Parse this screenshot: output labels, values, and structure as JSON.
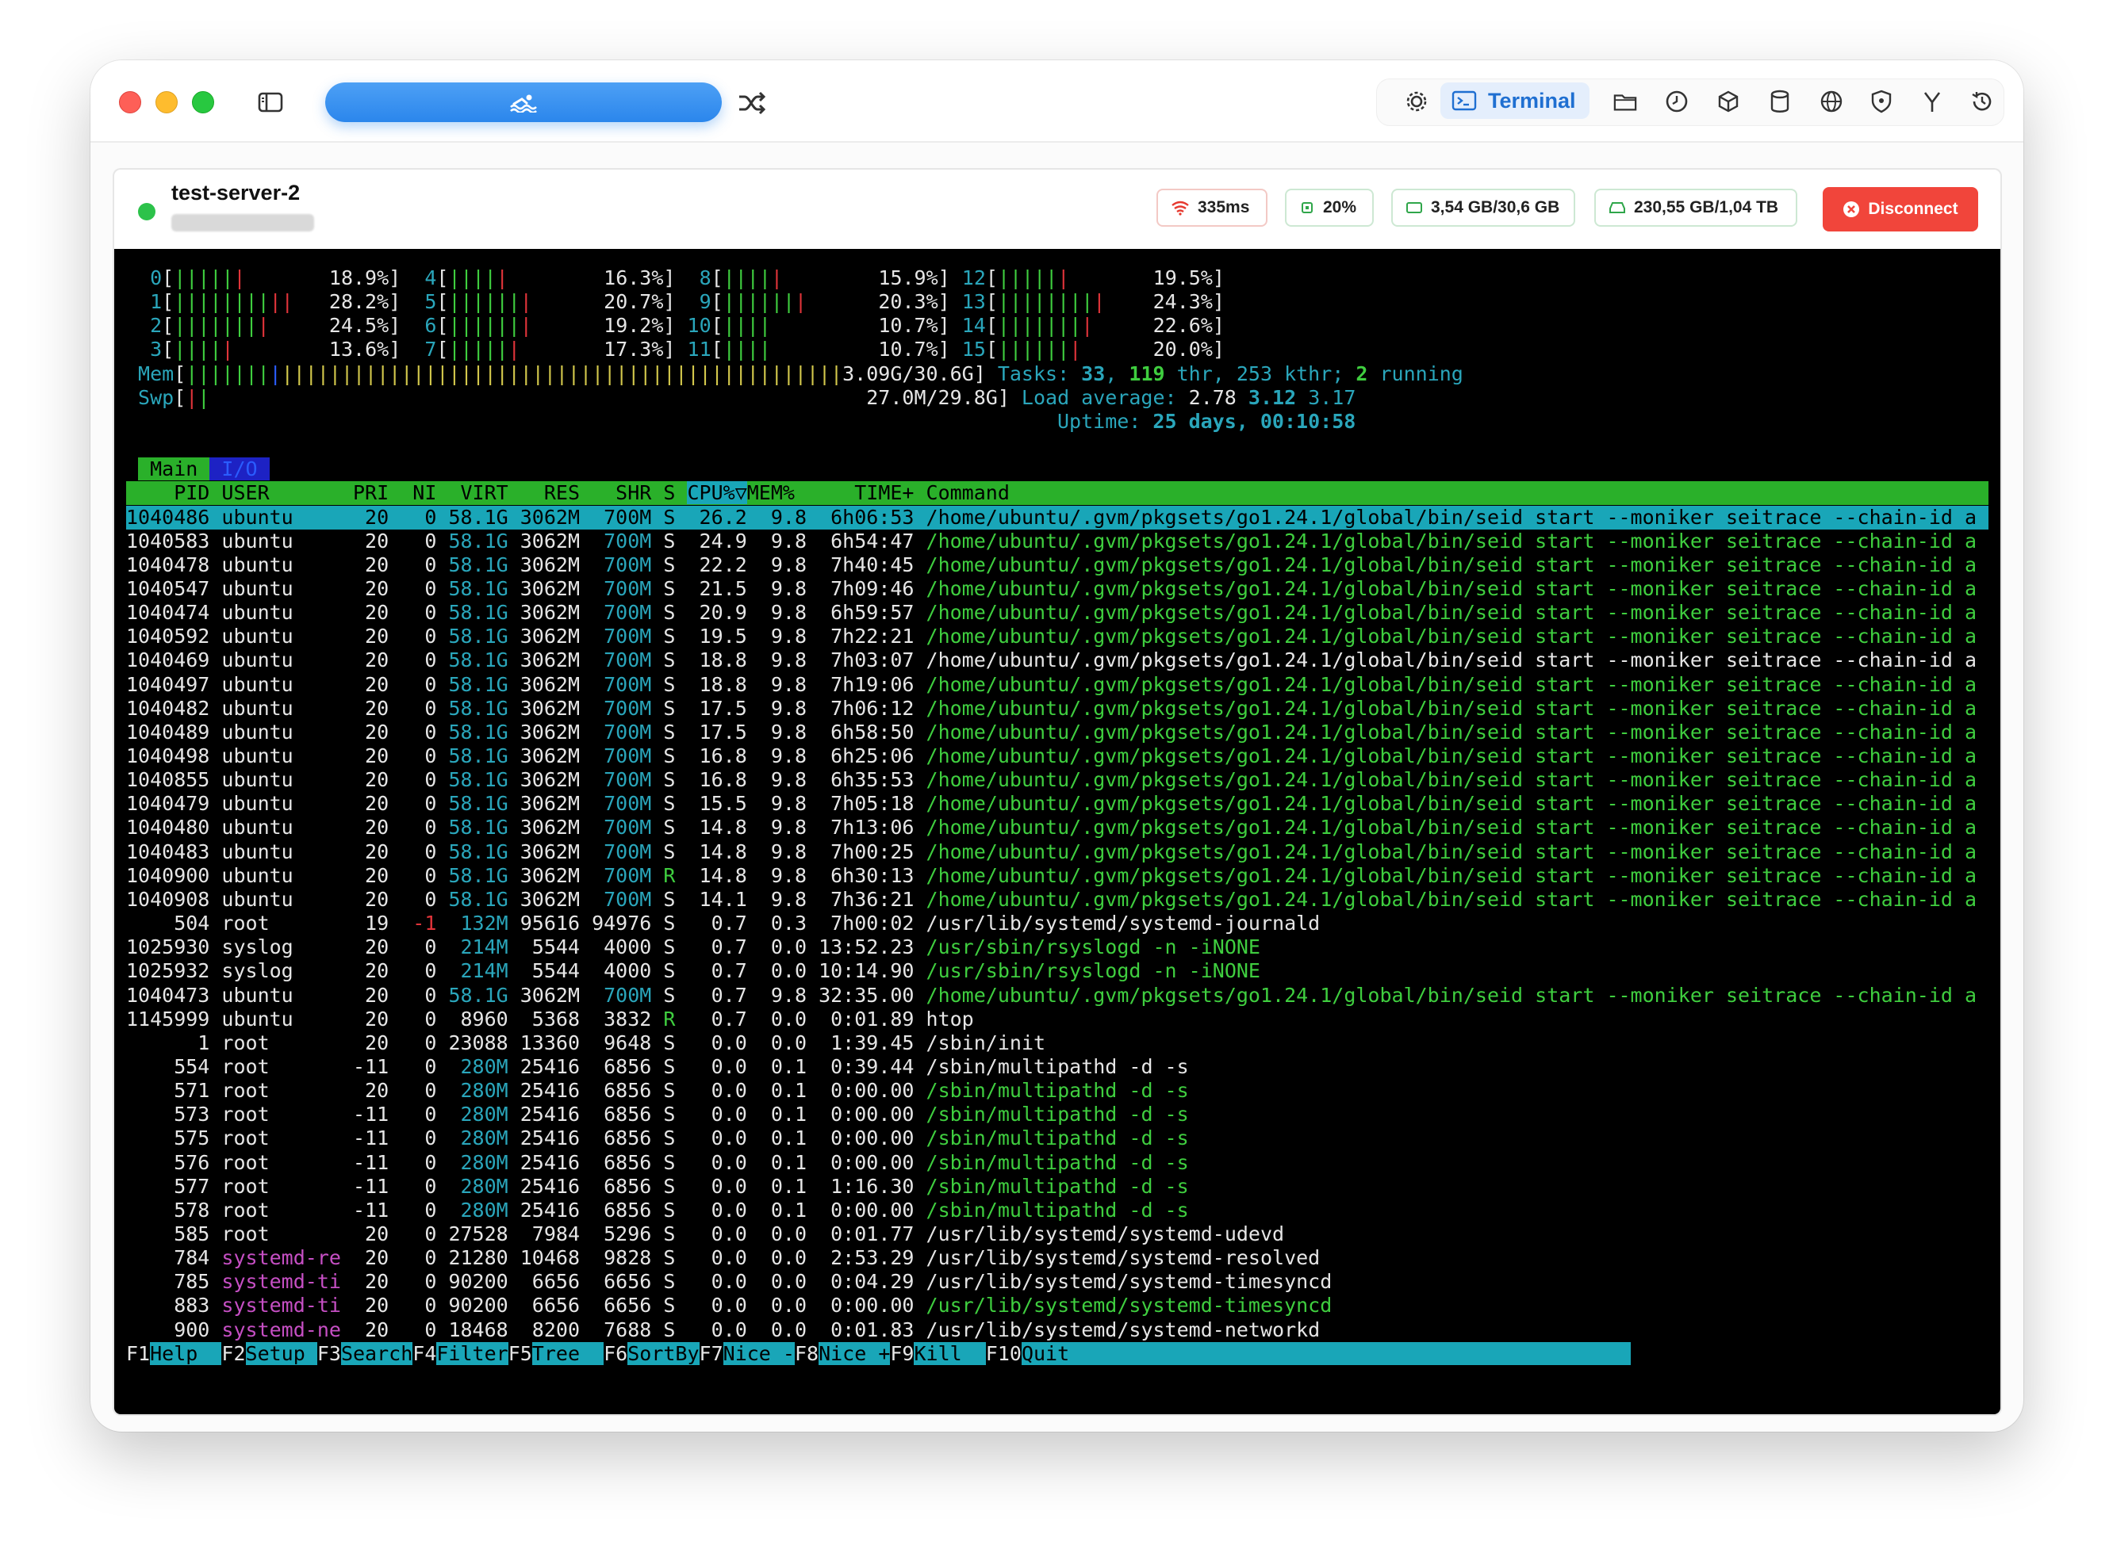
{
  "app": {
    "toolbar": {
      "terminal_label": "Terminal",
      "icons": [
        "sidebar-icon",
        "swimmer-icon",
        "shuffle-icon",
        "gear-icon",
        "terminal-icon",
        "folder-icon",
        "clock-icon",
        "cube-icon",
        "database-icon",
        "globe-icon",
        "shield-icon",
        "fork-icon",
        "history-icon"
      ]
    },
    "server": {
      "name": "test-server-2",
      "status_color": "#2cc24a",
      "latency": "335ms",
      "cpu": "20%",
      "memory": "3,54 GB/30,6 GB",
      "disk": "230,55 GB/1,04 TB",
      "disconnect_label": "Disconnect"
    }
  },
  "htop": {
    "cpus": [
      {
        "id": "0",
        "bar_g": "|||||",
        "bar_r": "|",
        "pct": "18.9%"
      },
      {
        "id": "1",
        "bar_g": "||||||||",
        "bar_r": "||",
        "pct": "28.2%"
      },
      {
        "id": "2",
        "bar_g": "|||||||",
        "bar_r": "|",
        "pct": "24.5%"
      },
      {
        "id": "3",
        "bar_g": "||||",
        "bar_r": "|",
        "pct": "13.6%"
      },
      {
        "id": "4",
        "bar_g": "||||",
        "bar_r": "|",
        "pct": "16.3%"
      },
      {
        "id": "5",
        "bar_g": "||||||",
        "bar_r": "|",
        "pct": "20.7%"
      },
      {
        "id": "6",
        "bar_g": "||||||",
        "bar_r": "|",
        "pct": "19.2%"
      },
      {
        "id": "7",
        "bar_g": "|||||",
        "bar_r": "|",
        "pct": "17.3%"
      },
      {
        "id": "8",
        "bar_g": "||||",
        "bar_r": "|",
        "pct": "15.9%"
      },
      {
        "id": "9",
        "bar_g": "||||||",
        "bar_r": "|",
        "pct": "20.3%"
      },
      {
        "id": "10",
        "bar_g": "||||",
        "bar_r": "",
        "pct": "10.7%"
      },
      {
        "id": "11",
        "bar_g": "||||",
        "bar_r": "",
        "pct": "10.7%"
      },
      {
        "id": "12",
        "bar_g": "|||||",
        "bar_r": "|",
        "pct": "19.5%"
      },
      {
        "id": "13",
        "bar_g": "||||||||",
        "bar_r": "|",
        "pct": "24.3%"
      },
      {
        "id": "14",
        "bar_g": "|||||||",
        "bar_r": "|",
        "pct": "22.6%"
      },
      {
        "id": "15",
        "bar_g": "||||||",
        "bar_r": "|",
        "pct": "20.0%"
      }
    ],
    "mem_label": "Mem",
    "mem_value": "3.09G/30.6G",
    "swp_label": "Swp",
    "swp_value": "27.0M/29.8G",
    "tasks_label": "Tasks:",
    "tasks": "33",
    "thr": "119",
    "thr_label": "thr,",
    "kthr": "253 kthr;",
    "running": "2",
    "running_label": "running",
    "load_label": "Load average:",
    "load1": "2.78",
    "load5": "3.12",
    "load15": "3.17",
    "uptime_label": "Uptime:",
    "uptime": "25 days, 00:10:58",
    "tabs": [
      "Main",
      "I/O"
    ],
    "header": [
      "PID",
      "USER",
      "PRI",
      "NI",
      "VIRT",
      "RES",
      "SHR",
      "S",
      "CPU%▽",
      "MEM%",
      "TIME+",
      "Command"
    ],
    "rows": [
      [
        "1040486",
        "ubuntu",
        "20",
        "0",
        "58.1G",
        "3062M",
        "700M",
        "S",
        "26.2",
        "9.8",
        "6h06:53",
        "/home/ubuntu/.gvm/pkgsets/go1.24.1/global/bin/seid start --moniker seitrace --chain-id a"
      ],
      [
        "1040583",
        "ubuntu",
        "20",
        "0",
        "58.1G",
        "3062M",
        "700M",
        "S",
        "24.9",
        "9.8",
        "6h54:47",
        "/home/ubuntu/.gvm/pkgsets/go1.24.1/global/bin/seid start --moniker seitrace --chain-id a"
      ],
      [
        "1040478",
        "ubuntu",
        "20",
        "0",
        "58.1G",
        "3062M",
        "700M",
        "S",
        "22.2",
        "9.8",
        "7h40:45",
        "/home/ubuntu/.gvm/pkgsets/go1.24.1/global/bin/seid start --moniker seitrace --chain-id a"
      ],
      [
        "1040547",
        "ubuntu",
        "20",
        "0",
        "58.1G",
        "3062M",
        "700M",
        "S",
        "21.5",
        "9.8",
        "7h09:46",
        "/home/ubuntu/.gvm/pkgsets/go1.24.1/global/bin/seid start --moniker seitrace --chain-id a"
      ],
      [
        "1040474",
        "ubuntu",
        "20",
        "0",
        "58.1G",
        "3062M",
        "700M",
        "S",
        "20.9",
        "9.8",
        "6h59:57",
        "/home/ubuntu/.gvm/pkgsets/go1.24.1/global/bin/seid start --moniker seitrace --chain-id a"
      ],
      [
        "1040592",
        "ubuntu",
        "20",
        "0",
        "58.1G",
        "3062M",
        "700M",
        "S",
        "19.5",
        "9.8",
        "7h22:21",
        "/home/ubuntu/.gvm/pkgsets/go1.24.1/global/bin/seid start --moniker seitrace --chain-id a"
      ],
      [
        "1040469",
        "ubuntu",
        "20",
        "0",
        "58.1G",
        "3062M",
        "700M",
        "S",
        "18.8",
        "9.8",
        "7h03:07",
        "/home/ubuntu/.gvm/pkgsets/go1.24.1/global/bin/seid start --moniker seitrace --chain-id a"
      ],
      [
        "1040497",
        "ubuntu",
        "20",
        "0",
        "58.1G",
        "3062M",
        "700M",
        "S",
        "18.8",
        "9.8",
        "7h19:06",
        "/home/ubuntu/.gvm/pkgsets/go1.24.1/global/bin/seid start --moniker seitrace --chain-id a"
      ],
      [
        "1040482",
        "ubuntu",
        "20",
        "0",
        "58.1G",
        "3062M",
        "700M",
        "S",
        "17.5",
        "9.8",
        "7h06:12",
        "/home/ubuntu/.gvm/pkgsets/go1.24.1/global/bin/seid start --moniker seitrace --chain-id a"
      ],
      [
        "1040489",
        "ubuntu",
        "20",
        "0",
        "58.1G",
        "3062M",
        "700M",
        "S",
        "17.5",
        "9.8",
        "6h58:50",
        "/home/ubuntu/.gvm/pkgsets/go1.24.1/global/bin/seid start --moniker seitrace --chain-id a"
      ],
      [
        "1040498",
        "ubuntu",
        "20",
        "0",
        "58.1G",
        "3062M",
        "700M",
        "S",
        "16.8",
        "9.8",
        "6h25:06",
        "/home/ubuntu/.gvm/pkgsets/go1.24.1/global/bin/seid start --moniker seitrace --chain-id a"
      ],
      [
        "1040855",
        "ubuntu",
        "20",
        "0",
        "58.1G",
        "3062M",
        "700M",
        "S",
        "16.8",
        "9.8",
        "6h35:53",
        "/home/ubuntu/.gvm/pkgsets/go1.24.1/global/bin/seid start --moniker seitrace --chain-id a"
      ],
      [
        "1040479",
        "ubuntu",
        "20",
        "0",
        "58.1G",
        "3062M",
        "700M",
        "S",
        "15.5",
        "9.8",
        "7h05:18",
        "/home/ubuntu/.gvm/pkgsets/go1.24.1/global/bin/seid start --moniker seitrace --chain-id a"
      ],
      [
        "1040480",
        "ubuntu",
        "20",
        "0",
        "58.1G",
        "3062M",
        "700M",
        "S",
        "14.8",
        "9.8",
        "7h13:06",
        "/home/ubuntu/.gvm/pkgsets/go1.24.1/global/bin/seid start --moniker seitrace --chain-id a"
      ],
      [
        "1040483",
        "ubuntu",
        "20",
        "0",
        "58.1G",
        "3062M",
        "700M",
        "S",
        "14.8",
        "9.8",
        "7h00:25",
        "/home/ubuntu/.gvm/pkgsets/go1.24.1/global/bin/seid start --moniker seitrace --chain-id a"
      ],
      [
        "1040900",
        "ubuntu",
        "20",
        "0",
        "58.1G",
        "3062M",
        "700M",
        "R",
        "14.8",
        "9.8",
        "6h30:13",
        "/home/ubuntu/.gvm/pkgsets/go1.24.1/global/bin/seid start --moniker seitrace --chain-id a"
      ],
      [
        "1040908",
        "ubuntu",
        "20",
        "0",
        "58.1G",
        "3062M",
        "700M",
        "S",
        "14.1",
        "9.8",
        "7h36:21",
        "/home/ubuntu/.gvm/pkgsets/go1.24.1/global/bin/seid start --moniker seitrace --chain-id a"
      ],
      [
        "504",
        "root",
        "19",
        "-1",
        "132M",
        "95616",
        "94976",
        "S",
        "0.7",
        "0.3",
        "7h00:02",
        "/usr/lib/systemd/systemd-journald"
      ],
      [
        "1025930",
        "syslog",
        "20",
        "0",
        "214M",
        "5544",
        "4000",
        "S",
        "0.7",
        "0.0",
        "13:52.23",
        "/usr/sbin/rsyslogd -n -iNONE"
      ],
      [
        "1025932",
        "syslog",
        "20",
        "0",
        "214M",
        "5544",
        "4000",
        "S",
        "0.7",
        "0.0",
        "10:14.90",
        "/usr/sbin/rsyslogd -n -iNONE"
      ],
      [
        "1040473",
        "ubuntu",
        "20",
        "0",
        "58.1G",
        "3062M",
        "700M",
        "S",
        "0.7",
        "9.8",
        "32:35.00",
        "/home/ubuntu/.gvm/pkgsets/go1.24.1/global/bin/seid start --moniker seitrace --chain-id a"
      ],
      [
        "1145999",
        "ubuntu",
        "20",
        "0",
        "8960",
        "5368",
        "3832",
        "R",
        "0.7",
        "0.0",
        "0:01.89",
        "htop"
      ],
      [
        "1",
        "root",
        "20",
        "0",
        "23088",
        "13360",
        "9648",
        "S",
        "0.0",
        "0.0",
        "1:39.45",
        "/sbin/init"
      ],
      [
        "554",
        "root",
        "-11",
        "0",
        "280M",
        "25416",
        "6856",
        "S",
        "0.0",
        "0.1",
        "0:39.44",
        "/sbin/multipathd -d -s"
      ],
      [
        "571",
        "root",
        "20",
        "0",
        "280M",
        "25416",
        "6856",
        "S",
        "0.0",
        "0.1",
        "0:00.00",
        "/sbin/multipathd -d -s"
      ],
      [
        "573",
        "root",
        "-11",
        "0",
        "280M",
        "25416",
        "6856",
        "S",
        "0.0",
        "0.1",
        "0:00.00",
        "/sbin/multipathd -d -s"
      ],
      [
        "575",
        "root",
        "-11",
        "0",
        "280M",
        "25416",
        "6856",
        "S",
        "0.0",
        "0.1",
        "0:00.00",
        "/sbin/multipathd -d -s"
      ],
      [
        "576",
        "root",
        "-11",
        "0",
        "280M",
        "25416",
        "6856",
        "S",
        "0.0",
        "0.1",
        "0:00.00",
        "/sbin/multipathd -d -s"
      ],
      [
        "577",
        "root",
        "-11",
        "0",
        "280M",
        "25416",
        "6856",
        "S",
        "0.0",
        "0.1",
        "1:16.30",
        "/sbin/multipathd -d -s"
      ],
      [
        "578",
        "root",
        "-11",
        "0",
        "280M",
        "25416",
        "6856",
        "S",
        "0.0",
        "0.1",
        "0:00.00",
        "/sbin/multipathd -d -s"
      ],
      [
        "585",
        "root",
        "20",
        "0",
        "27528",
        "7984",
        "5296",
        "S",
        "0.0",
        "0.0",
        "0:01.77",
        "/usr/lib/systemd/systemd-udevd"
      ],
      [
        "784",
        "systemd-re",
        "20",
        "0",
        "21280",
        "10468",
        "9828",
        "S",
        "0.0",
        "0.0",
        "2:53.29",
        "/usr/lib/systemd/systemd-resolved"
      ],
      [
        "785",
        "systemd-ti",
        "20",
        "0",
        "90200",
        "6656",
        "6656",
        "S",
        "0.0",
        "0.0",
        "0:04.29",
        "/usr/lib/systemd/systemd-timesyncd"
      ],
      [
        "883",
        "systemd-ti",
        "20",
        "0",
        "90200",
        "6656",
        "6656",
        "S",
        "0.0",
        "0.0",
        "0:00.00",
        "/usr/lib/systemd/systemd-timesyncd"
      ],
      [
        "900",
        "systemd-ne",
        "20",
        "0",
        "18468",
        "8200",
        "7688",
        "S",
        "0.0",
        "0.0",
        "0:01.83",
        "/usr/lib/systemd/systemd-networkd"
      ]
    ],
    "fkeys": [
      {
        "key": "F1",
        "label": "Help  "
      },
      {
        "key": "F2",
        "label": "Setup "
      },
      {
        "key": "F3",
        "label": "Search"
      },
      {
        "key": "F4",
        "label": "Filter"
      },
      {
        "key": "F5",
        "label": "Tree  "
      },
      {
        "key": "F6",
        "label": "SortBy"
      },
      {
        "key": "F7",
        "label": "Nice -"
      },
      {
        "key": "F8",
        "label": "Nice +"
      },
      {
        "key": "F9",
        "label": "Kill  "
      },
      {
        "key": "F10",
        "label": "Quit"
      }
    ]
  }
}
